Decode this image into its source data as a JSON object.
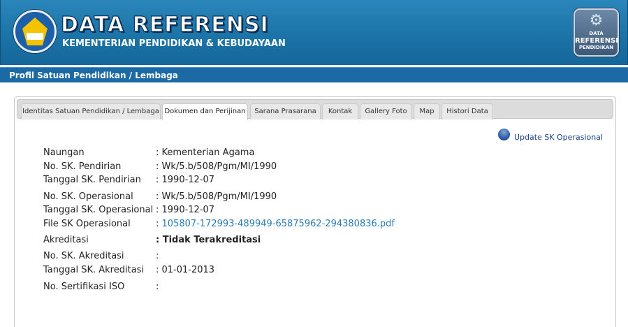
{
  "header": {
    "title": "DATA REFERENSI",
    "subtitle": "KEMENTERIAN PENDIDIKAN & KEBUDAYAAN",
    "badge": {
      "line1": "DATA",
      "line2": "REFERENSI",
      "line3": "PENDIDIKAN"
    }
  },
  "section_title": "Profil Satuan Pendidikan / Lembaga",
  "tabs": [
    {
      "label": "Identitas Satuan Pendidikan / Lembaga"
    },
    {
      "label": "Dokumen dan Perijinan"
    },
    {
      "label": "Sarana Prasarana"
    },
    {
      "label": "Kontak"
    },
    {
      "label": "Gallery Foto"
    },
    {
      "label": "Map"
    },
    {
      "label": "Histori Data"
    }
  ],
  "active_tab": "Dokumen dan Perijinan",
  "update_link": "Update SK Operasional",
  "fields": [
    {
      "label": "Naungan",
      "value": ": Kementerian Agama"
    },
    {
      "label": "No. SK. Pendirian",
      "value": ": Wk/5.b/508/Pgm/MI/1990"
    },
    {
      "label": "Tanggal SK. Pendirian",
      "value": ": 1990-12-07"
    },
    {
      "label": "No. SK. Operasional",
      "value": ": Wk/5.b/508/Pgm/MI/1990"
    },
    {
      "label": "Tanggal SK. Operasional",
      "value": ": 1990-12-07"
    },
    {
      "label": "File SK Operasional",
      "colon": ": ",
      "link": "105807-172993-489949-65875962-294380836.pdf"
    },
    {
      "label": "Akreditasi",
      "value": ": Tidak Terakreditasi"
    },
    {
      "label": "No. SK. Akreditasi",
      "value": ":"
    },
    {
      "label": "Tanggal SK. Akreditasi",
      "value": ": 01-01-2013"
    },
    {
      "label": "No. Sertifikasi ISO",
      "value": ":"
    }
  ],
  "colors": {
    "header_blue": "#1b73a6",
    "section_bar": "#1b6aa6",
    "link_color": "#2b7ab8"
  }
}
